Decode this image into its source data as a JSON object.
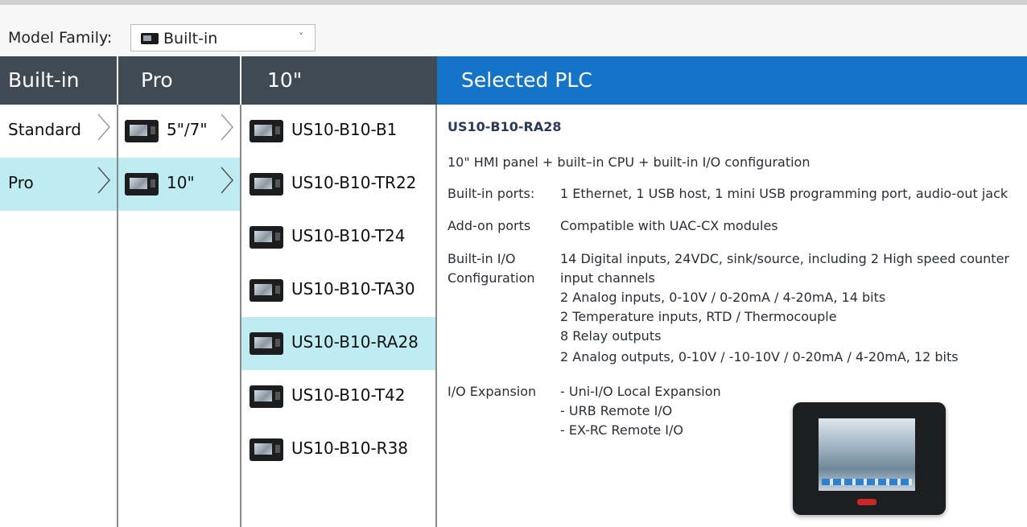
{
  "toolbar": {
    "model_family_label": "Model Family:",
    "model_family_value": "Built-in"
  },
  "columns": {
    "c1_header": "Built-in",
    "c2_header": "Pro",
    "c3_header": "10\"",
    "c4_header": "Selected PLC"
  },
  "col1_items": [
    {
      "label": "Standard",
      "selected": false
    },
    {
      "label": "Pro",
      "selected": true
    }
  ],
  "col2_items": [
    {
      "label": "5\"/7\"",
      "selected": false
    },
    {
      "label": "10\"",
      "selected": true
    }
  ],
  "col3_items": [
    {
      "label": "US10-B10-B1",
      "selected": false
    },
    {
      "label": "US10-B10-TR22",
      "selected": false
    },
    {
      "label": "US10-B10-T24",
      "selected": false
    },
    {
      "label": "US10-B10-TA30",
      "selected": false
    },
    {
      "label": "US10-B10-RA28",
      "selected": true
    },
    {
      "label": "US10-B10-T42",
      "selected": false
    },
    {
      "label": "US10-B10-R38",
      "selected": false
    }
  ],
  "details": {
    "title": "US10-B10-RA28",
    "description": "10\" HMI panel + built–in CPU + built-in I/O configuration",
    "builtin_ports_label": "Built-in ports:",
    "builtin_ports_value": "1 Ethernet, 1 USB host, 1 mini USB programming port, audio-out jack",
    "addon_ports_label": "Add-on ports",
    "addon_ports_value": "Compatible with UAC-CX modules",
    "io_config_label_1": "Built-in I/O",
    "io_config_label_2": "Configuration",
    "io_lines": [
      "14 Digital inputs, 24VDC, sink/source, including 2 High speed counter",
      "input channels",
      "2  Analog inputs, 0-10V / 0-20mA / 4-20mA, 14 bits",
      "2  Temperature inputs, RTD / Thermocouple",
      "8  Relay outputs",
      "2  Analog outputs, 0-10V / -10-10V / 0-20mA / 4-20mA, 12 bits"
    ],
    "io_expansion_label": "I/O Expansion",
    "io_expansion_lines": [
      "- Uni-I/O Local Expansion",
      "- URB Remote I/O",
      "- EX-RC Remote I/O"
    ]
  },
  "colors": {
    "header_dark": "#3f4a55",
    "header_blue": "#1674c8",
    "selection": "#bfecf2"
  }
}
